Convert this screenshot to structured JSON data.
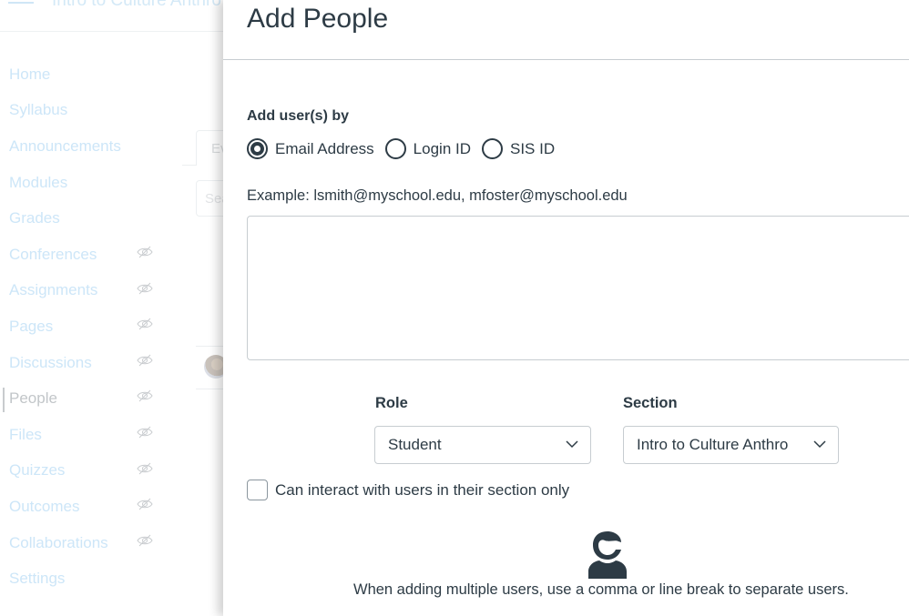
{
  "background": {
    "course_title": "Intro to Culture Anthro",
    "nav": [
      {
        "label": "Home",
        "hidden": false,
        "active": false
      },
      {
        "label": "Syllabus",
        "hidden": false,
        "active": false
      },
      {
        "label": "Announcements",
        "hidden": false,
        "active": false
      },
      {
        "label": "Modules",
        "hidden": false,
        "active": false
      },
      {
        "label": "Grades",
        "hidden": false,
        "active": false
      },
      {
        "label": "Conferences",
        "hidden": true,
        "active": false
      },
      {
        "label": "Assignments",
        "hidden": true,
        "active": false
      },
      {
        "label": "Pages",
        "hidden": true,
        "active": false
      },
      {
        "label": "Discussions",
        "hidden": true,
        "active": false
      },
      {
        "label": "People",
        "hidden": true,
        "active": true
      },
      {
        "label": "Files",
        "hidden": true,
        "active": false
      },
      {
        "label": "Quizzes",
        "hidden": true,
        "active": false
      },
      {
        "label": "Outcomes",
        "hidden": true,
        "active": false
      },
      {
        "label": "Collaborations",
        "hidden": true,
        "active": false
      },
      {
        "label": "Settings",
        "hidden": false,
        "active": false
      }
    ],
    "tab_partial": "Ev",
    "search_partial": "Sea"
  },
  "modal": {
    "title": "Add People",
    "add_by_label": "Add user(s) by",
    "add_by_options": [
      {
        "label": "Email Address",
        "checked": true
      },
      {
        "label": "Login ID",
        "checked": false
      },
      {
        "label": "SIS ID",
        "checked": false
      }
    ],
    "example_text": "Example: lsmith@myschool.edu, mfoster@myschool.edu",
    "users_input_value": "",
    "role": {
      "label": "Role",
      "selected": "Student"
    },
    "section": {
      "label": "Section",
      "selected": "Intro to Culture Anthro"
    },
    "section_only_checkbox": {
      "label": "Can interact with users in their section only",
      "checked": false
    },
    "hint_text": "When adding multiple users, use a comma or line break to separate users.",
    "hint_icon": "person-icon"
  }
}
